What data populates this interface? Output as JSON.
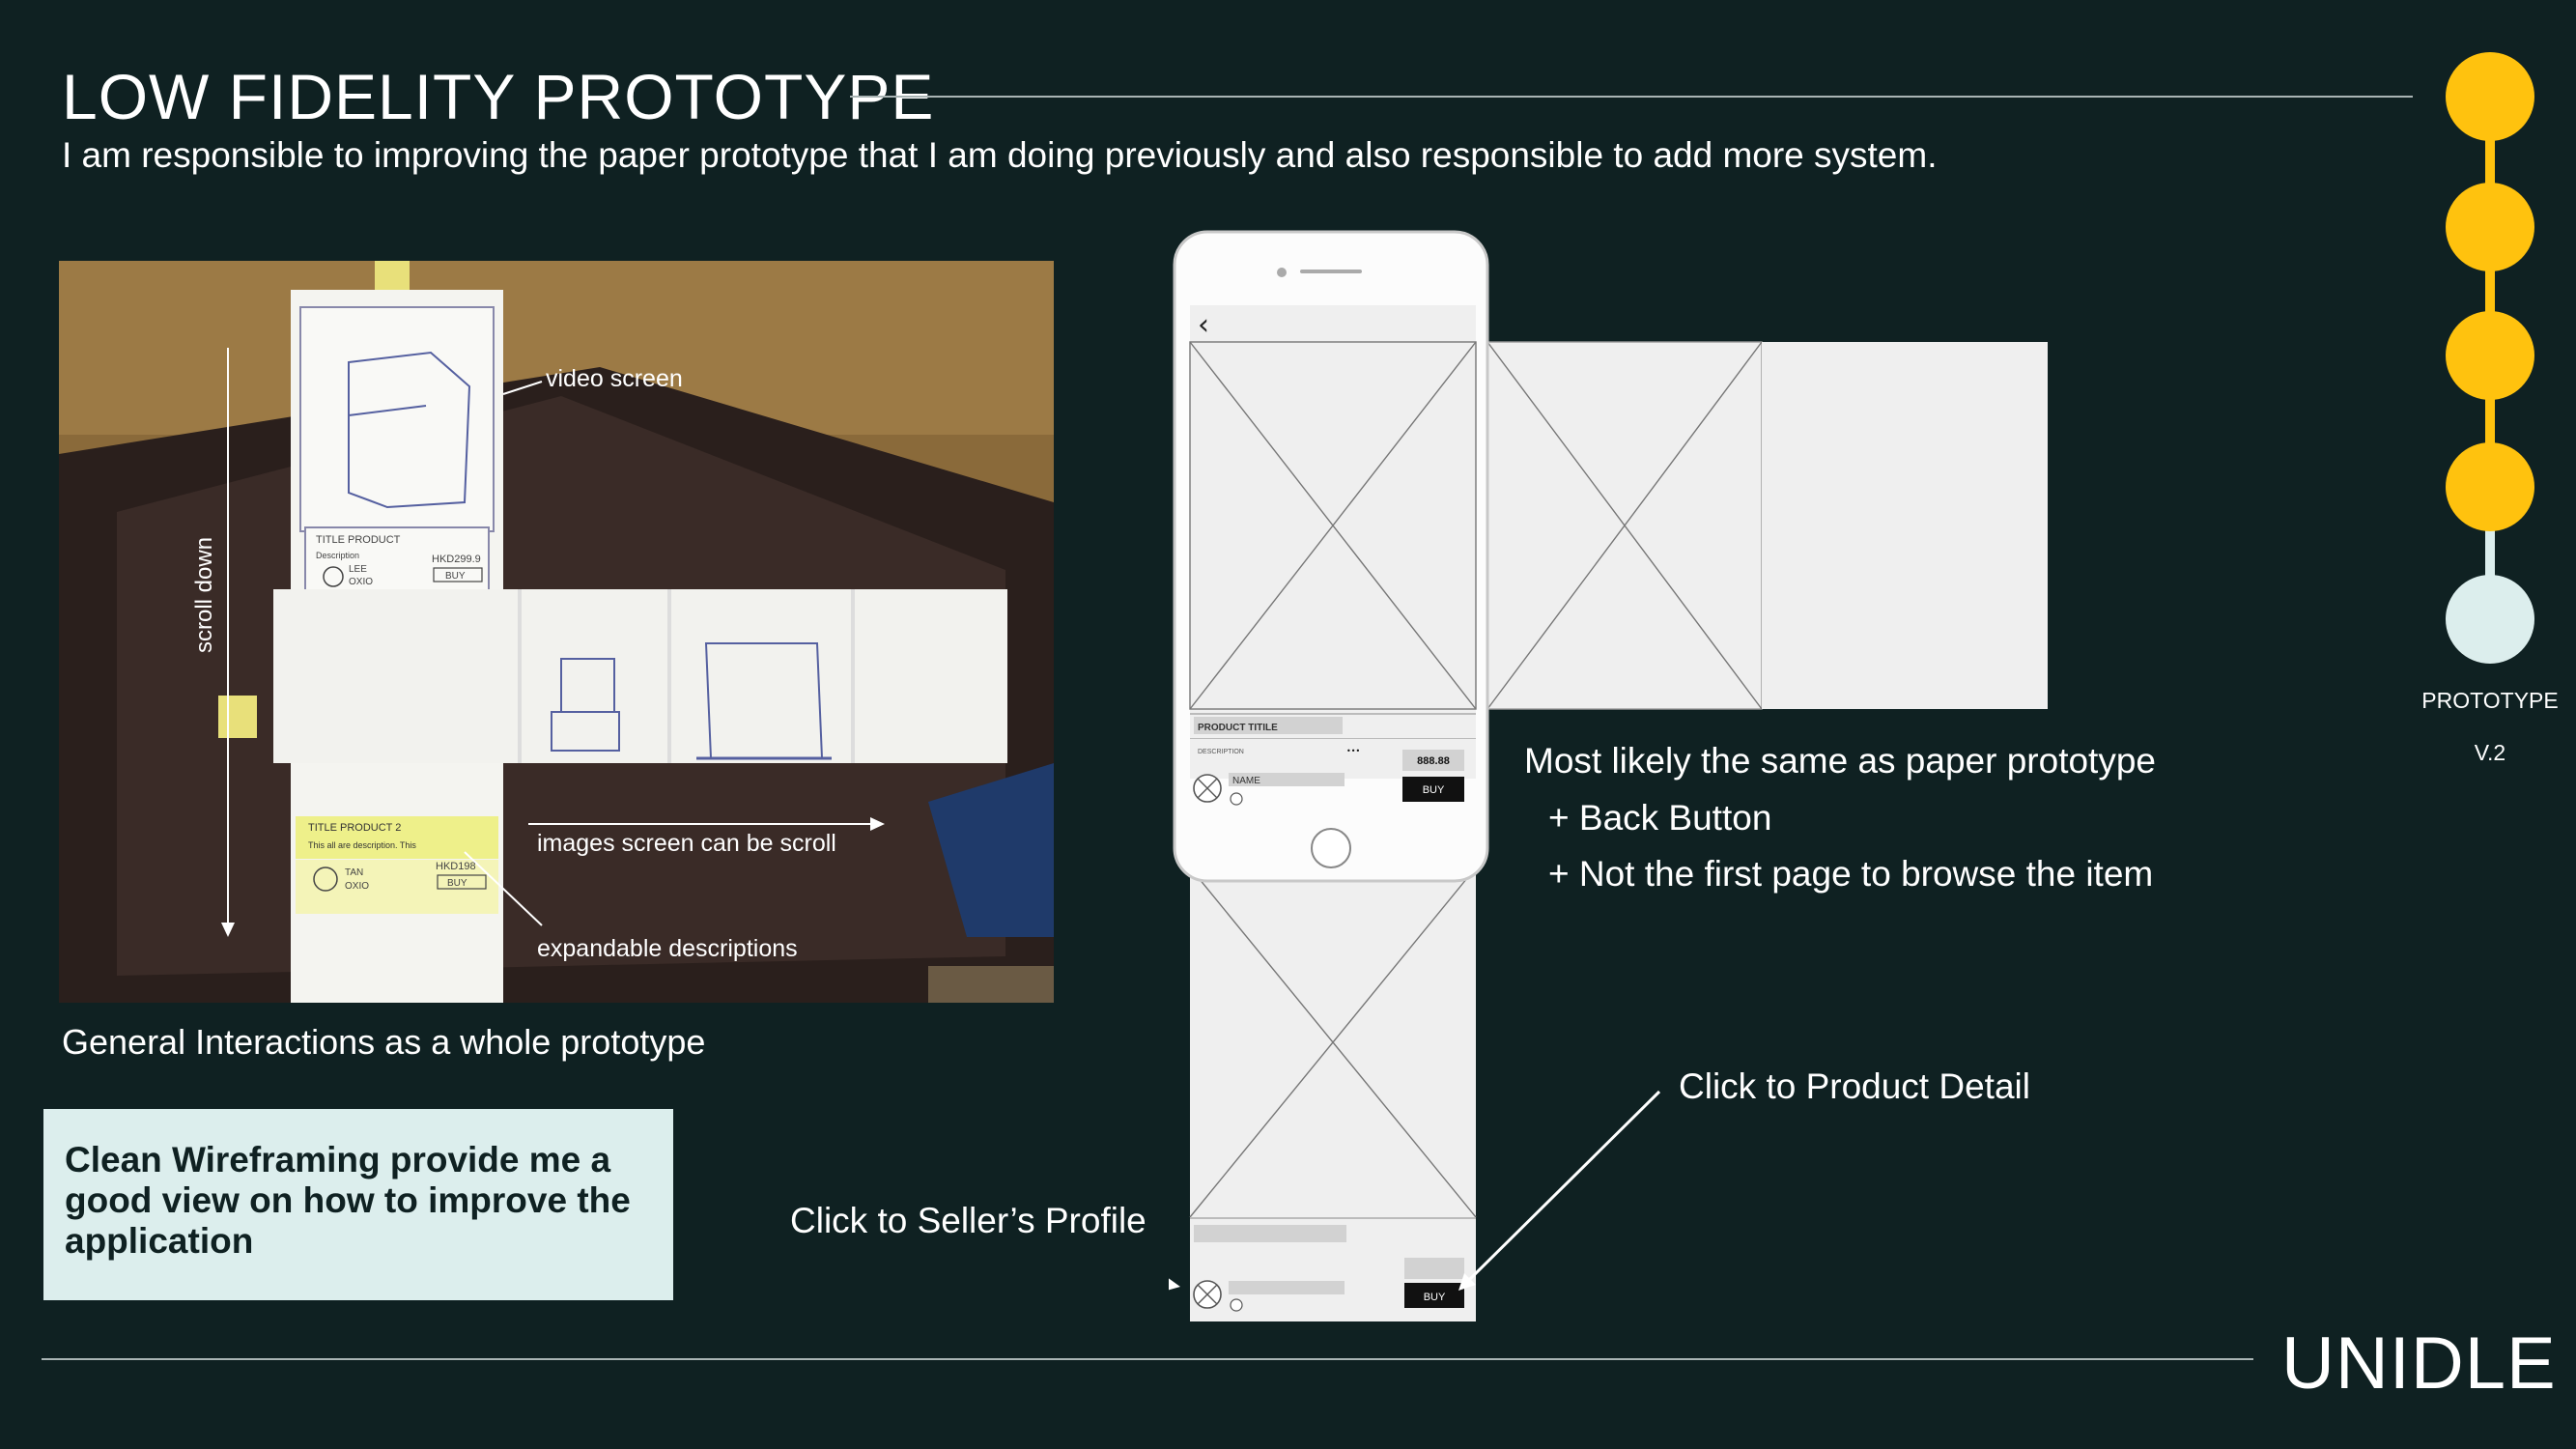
{
  "header": {
    "title": "LOW FIDELITY PROTOTYPE",
    "subtitle": "I am responsible to improving the paper prototype that I am doing previously and also responsible to add more system."
  },
  "tracker": {
    "label": "PROTOTYPE",
    "version": "V.2",
    "active_step": 5,
    "total_steps": 5,
    "colors": {
      "done": "#ffc20e",
      "active": "#dceeed"
    }
  },
  "photo": {
    "caption": "General Interactions as a whole prototype",
    "annotations": {
      "video_screen": "video screen",
      "scroll_down": "scroll down",
      "images_scroll": "images screen can be scroll",
      "expandable": "expandable descriptions"
    },
    "paper_text": {
      "title_product": "TITLE PRODUCT",
      "description": "Description",
      "seller_line1": "LEE",
      "seller_line2": "OXIO",
      "price": "HKD299.9",
      "buy": "BUY",
      "title_product_2": "TITLE PRODUCT 2",
      "description_2": "This all are description. This",
      "seller2_line1": "TAN",
      "seller2_line2": "OXIO",
      "price_2": "HKD198",
      "buy_2": "BUY"
    }
  },
  "note": {
    "text": "Clean Wireframing provide me a good view on how to improve the application"
  },
  "wireframe": {
    "product_title": "PRODUCT TITILE",
    "description_label": "DESCRIPTION",
    "more_dots": "•••",
    "seller_name": "NAME",
    "price": "888.88",
    "buy_label": "BUY",
    "buy_label_2": "BUY",
    "back_glyph": "‹",
    "notes_line1": "Most likely the same as paper prototype",
    "notes_line2": "+ Back Button",
    "notes_line3": "+ Not the first page to browse the item",
    "click_product": "Click to Product Detail",
    "click_seller": "Click to Seller’s Profile"
  },
  "footer": {
    "brand": "UNIDLE"
  }
}
